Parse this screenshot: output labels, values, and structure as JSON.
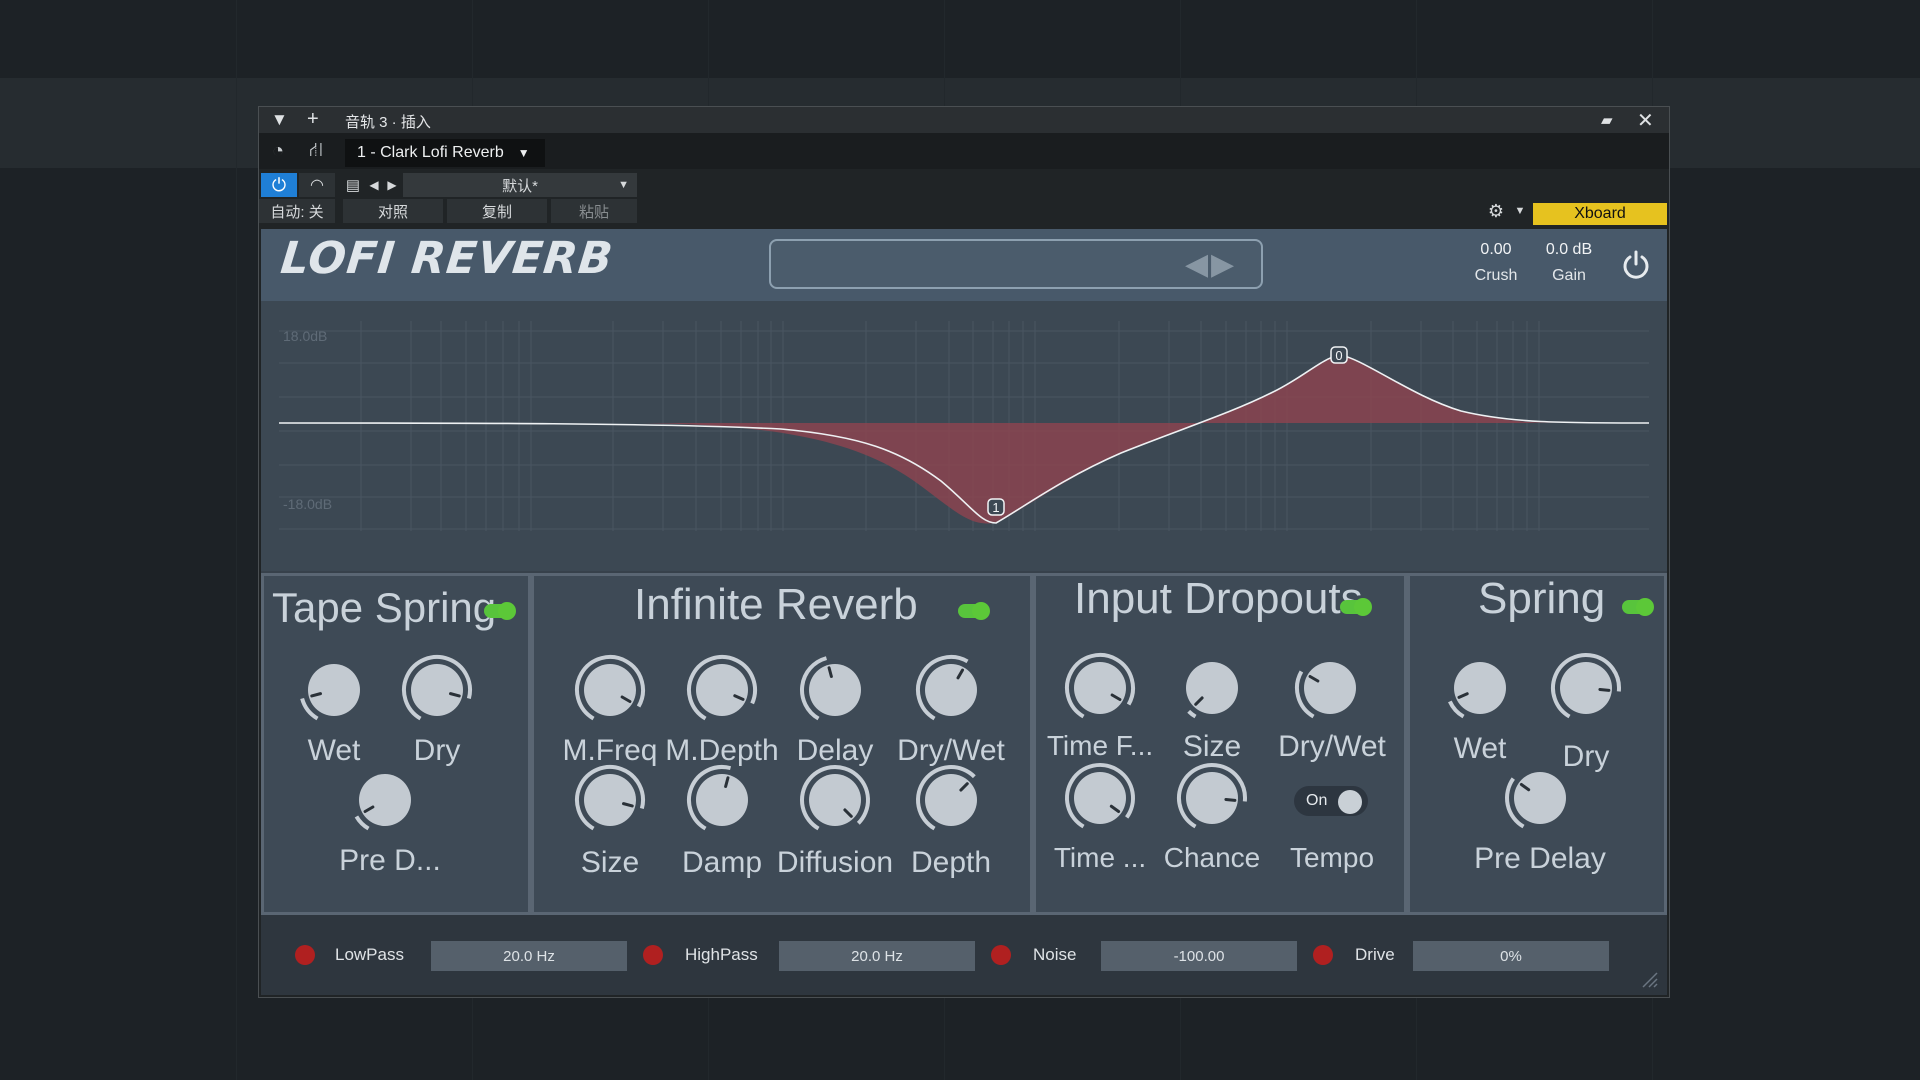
{
  "host": {
    "title": "音轨 3 · 插入",
    "preset_selector": "1 - Clark Lofi Reverb",
    "preset_name": "默认*",
    "automation": "自动: 关",
    "compare": "对照",
    "copy": "复制",
    "paste": "粘贴",
    "xboard": "Xboard"
  },
  "plugin": {
    "logo": "LOFI REVERB",
    "crush": {
      "value": "0.00",
      "label": "Crush"
    },
    "gain": {
      "value": "0.0 dB",
      "label": "Gain"
    },
    "eq": {
      "top_label": "18.0dB",
      "bottom_label": "-18.0dB",
      "nodes": [
        {
          "id": "0",
          "type": "peak"
        },
        {
          "id": "1",
          "type": "dip"
        }
      ]
    },
    "sections": {
      "tape_spring": {
        "title": "Tape Spring",
        "enabled": true,
        "knobs": [
          "Wet",
          "Dry",
          "Pre D..."
        ]
      },
      "infinite_reverb": {
        "title": "Infinite Reverb",
        "enabled": true,
        "knobs": [
          "M.Freq",
          "M.Depth",
          "Delay",
          "Dry/Wet",
          "Size",
          "Damp",
          "Diffusion",
          "Depth"
        ]
      },
      "input_dropouts": {
        "title": "Input Dropouts",
        "enabled": true,
        "knobs": [
          "Time F...",
          "Size",
          "Dry/Wet",
          "Time ...",
          "Chance"
        ],
        "tempo_toggle": {
          "state": "On",
          "label": "Tempo"
        }
      },
      "spring": {
        "title": "Spring",
        "enabled": true,
        "knobs": [
          "Wet",
          "Dry",
          "Pre Delay"
        ]
      }
    },
    "footer": {
      "lowpass": {
        "label": "LowPass",
        "value": "20.0 Hz"
      },
      "highpass": {
        "label": "HighPass",
        "value": "20.0 Hz"
      },
      "noise": {
        "label": "Noise",
        "value": "-100.00"
      },
      "drive": {
        "label": "Drive",
        "value": "0%"
      }
    }
  }
}
